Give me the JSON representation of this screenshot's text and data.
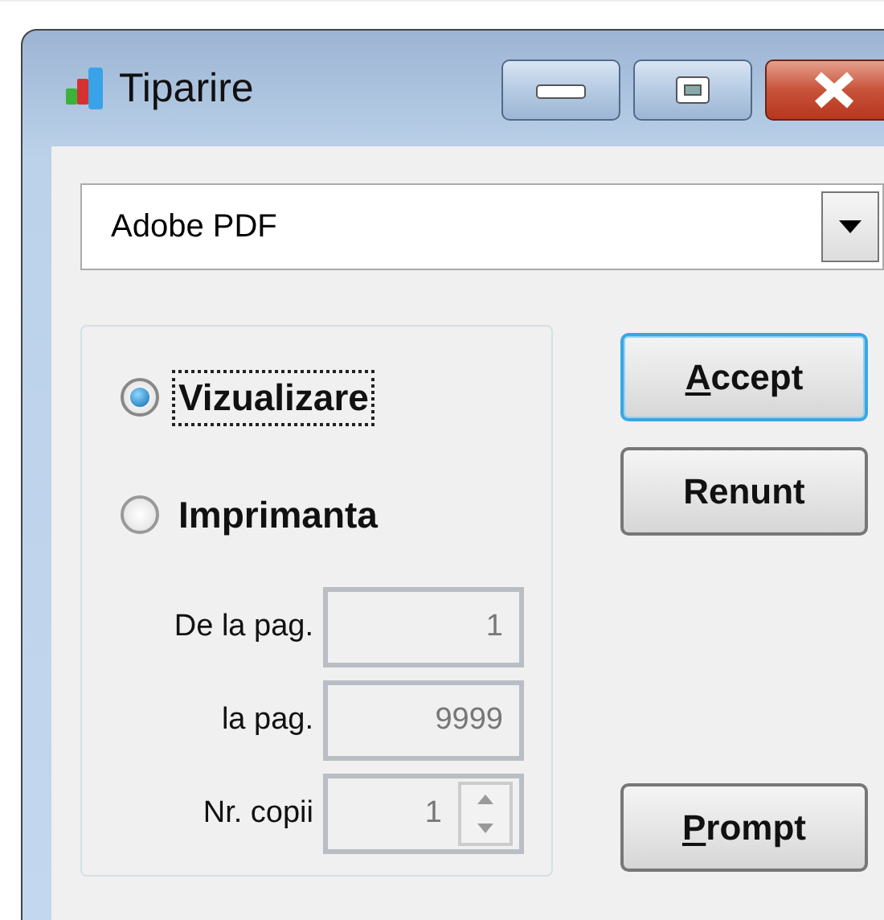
{
  "window": {
    "title": "Tiparire"
  },
  "printer": {
    "value": "Adobe PDF"
  },
  "output": [
    {
      "label": "Vizualizare",
      "selected": true,
      "focused": true
    },
    {
      "label": "Imprimanta",
      "selected": false,
      "focused": false
    }
  ],
  "fields": [
    {
      "label": "De la pag.",
      "value": "1",
      "spinner": false,
      "disabled": true
    },
    {
      "label": "la pag.",
      "value": "9999",
      "spinner": false,
      "disabled": true
    },
    {
      "label": "Nr. copii",
      "value": "1",
      "spinner": true,
      "disabled": true
    }
  ],
  "buttons": [
    {
      "label": "Accept",
      "underline_first": true,
      "default": true
    },
    {
      "label": "Renunt",
      "underline_first": false,
      "default": false
    },
    {
      "label": "Prompt",
      "underline_first": true,
      "default": false
    }
  ]
}
